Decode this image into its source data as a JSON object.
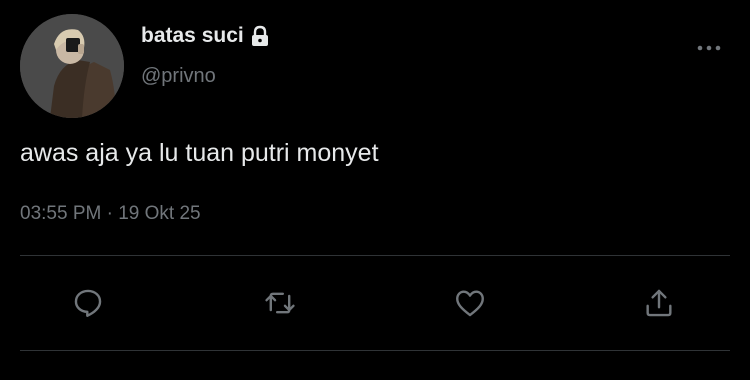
{
  "tweet": {
    "display_name": "batas suci",
    "handle": "@privno",
    "text": "awas aja ya lu tuan putri monyet",
    "time": "03:55 PM",
    "separator": "·",
    "date": "19 Okt 25",
    "protected_icon": "lock-icon",
    "more_icon": "more-horizontal-icon"
  },
  "actions": [
    {
      "name": "reply",
      "icon": "reply-icon"
    },
    {
      "name": "retweet",
      "icon": "retweet-icon"
    },
    {
      "name": "like",
      "icon": "heart-icon"
    },
    {
      "name": "share",
      "icon": "share-icon"
    }
  ],
  "colors": {
    "background": "#000000",
    "primary_text": "#e7e9ea",
    "secondary_text": "#71767b",
    "divider": "#2f3336"
  }
}
